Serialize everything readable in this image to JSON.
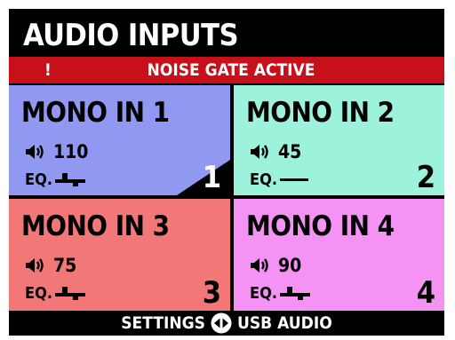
{
  "header": {
    "title": "AUDIO INPUTS"
  },
  "banner": {
    "icon_text": "!",
    "message": "NOISE GATE ACTIVE",
    "color": "#c8101a"
  },
  "channels": [
    {
      "name": "MONO IN 1",
      "volume": "110",
      "eq_label": "EQ.",
      "eq_icon": "eq-curve-icon",
      "number": "1",
      "color": "#9098f2",
      "selected": true
    },
    {
      "name": "MONO IN 2",
      "volume": "45",
      "eq_label": "EQ.",
      "eq_icon": "eq-flat-icon",
      "number": "2",
      "color": "#9df2db",
      "selected": false
    },
    {
      "name": "MONO IN 3",
      "volume": "75",
      "eq_label": "EQ.",
      "eq_icon": "eq-curve-icon",
      "number": "3",
      "color": "#f27878",
      "selected": false
    },
    {
      "name": "MONO IN 4",
      "volume": "90",
      "eq_label": "EQ.",
      "eq_icon": "eq-curve-icon",
      "number": "4",
      "color": "#f593f5",
      "selected": false
    }
  ],
  "footer": {
    "left_label": "SETTINGS",
    "right_label": "USB AUDIO",
    "nav_icon": "left-right-arrows-icon"
  }
}
